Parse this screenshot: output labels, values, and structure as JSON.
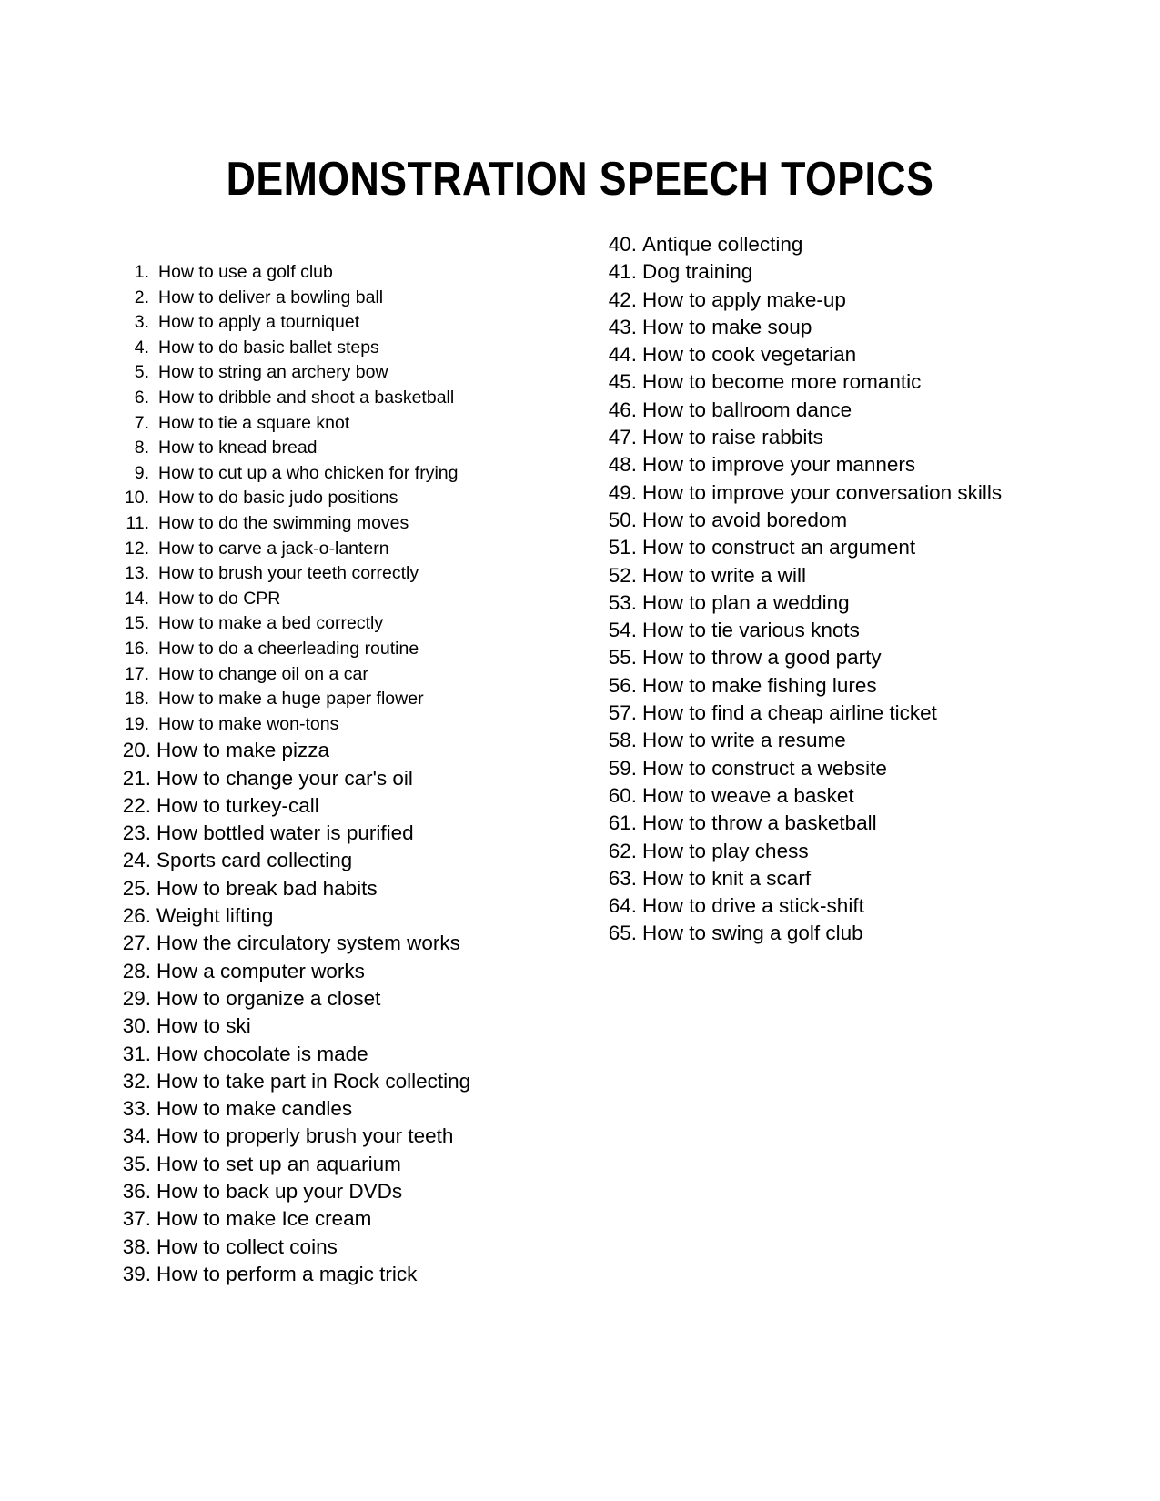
{
  "document": {
    "title": "DEMONSTRATION SPEECH TOPICS",
    "background_color": "#ffffff",
    "text_color": "#000000"
  },
  "columns": {
    "left": {
      "group_small": [
        {
          "number": "1.",
          "text": "How to use a golf club"
        },
        {
          "number": "2.",
          "text": "How to  deliver a bowling ball"
        },
        {
          "number": "3.",
          "text": "How to  apply a tourniquet"
        },
        {
          "number": "4.",
          "text": "How to  do basic ballet steps"
        },
        {
          "number": "5.",
          "text": "How to  string an archery bow"
        },
        {
          "number": "6.",
          "text": "How to  dribble and shoot a basketball"
        },
        {
          "number": "7.",
          "text": "How to  tie a square knot"
        },
        {
          "number": "8.",
          "text": "How to  knead bread"
        },
        {
          "number": "9.",
          "text": "How to  cut up a who chicken for frying"
        },
        {
          "number": "10.",
          "text": "How to  do basic judo positions"
        },
        {
          "number": "11.",
          "text": "How to  do the swimming moves"
        },
        {
          "number": "12.",
          "text": "How to  carve a jack-o-lantern"
        },
        {
          "number": "13.",
          "text": "How to  brush your teeth correctly"
        },
        {
          "number": "14.",
          "text": "How to do CPR"
        },
        {
          "number": "15.",
          "text": "How to make a bed correctly"
        },
        {
          "number": "16.",
          "text": "How to  do a cheerleading routine"
        },
        {
          "number": "17.",
          "text": "How to change oil on a car"
        },
        {
          "number": "18.",
          "text": "How to make a huge paper flower"
        },
        {
          "number": "19.",
          "text": "How to make won-tons"
        }
      ],
      "group_large": [
        {
          "number": "20.",
          "text": "How to make pizza"
        },
        {
          "number": "21.",
          "text": "How to change your car's oil"
        },
        {
          "number": "22.",
          "text": "How to turkey-call"
        },
        {
          "number": "23.",
          "text": "How bottled water is purified"
        },
        {
          "number": "24.",
          "text": "Sports card collecting"
        },
        {
          "number": "25.",
          "text": "How to break bad habits"
        },
        {
          "number": "26.",
          "text": "Weight lifting"
        },
        {
          "number": "27.",
          "text": "How the circulatory system works"
        },
        {
          "number": "28.",
          "text": "How a computer works"
        },
        {
          "number": "29.",
          "text": "How to organize a closet"
        },
        {
          "number": "30.",
          "text": "How to ski"
        },
        {
          "number": "31.",
          "text": "How chocolate is made"
        },
        {
          "number": "32.",
          "text": "How to take part in Rock collecting"
        },
        {
          "number": "33.",
          "text": "How to make candles"
        },
        {
          "number": "34.",
          "text": "How to properly brush your teeth"
        },
        {
          "number": "35.",
          "text": "How to set up an aquarium"
        },
        {
          "number": "36.",
          "text": "How to back up your DVDs"
        },
        {
          "number": "37.",
          "text": "How to make Ice cream"
        },
        {
          "number": "38.",
          "text": "How to collect coins"
        },
        {
          "number": "39.",
          "text": "How to perform a magic trick"
        }
      ]
    },
    "right": {
      "items": [
        {
          "number": "40.",
          "text": "Antique collecting"
        },
        {
          "number": "41.",
          "text": "Dog training"
        },
        {
          "number": "42.",
          "text": "How to apply make-up"
        },
        {
          "number": "43.",
          "text": "How to make soup"
        },
        {
          "number": "44.",
          "text": "How to cook vegetarian"
        },
        {
          "number": "45.",
          "text": "How to become more romantic"
        },
        {
          "number": "46.",
          "text": "How to ballroom dance"
        },
        {
          "number": "47.",
          "text": "How to raise rabbits"
        },
        {
          "number": "48.",
          "text": "How to improve your manners"
        },
        {
          "number": "49.",
          "text": "How to improve your conversation skills"
        },
        {
          "number": "50.",
          "text": "How to avoid boredom"
        },
        {
          "number": "51.",
          "text": "How to construct an argument"
        },
        {
          "number": "52.",
          "text": "How to write a will"
        },
        {
          "number": "53.",
          "text": "How to plan a wedding"
        },
        {
          "number": "54.",
          "text": "How to tie various knots"
        },
        {
          "number": "55.",
          "text": "How to throw a good party"
        },
        {
          "number": "56.",
          "text": "How to make fishing lures"
        },
        {
          "number": "57.",
          "text": "How to find a cheap airline ticket"
        },
        {
          "number": "58.",
          "text": "How to write a resume"
        },
        {
          "number": "59.",
          "text": "How to construct a website"
        },
        {
          "number": "60.",
          "text": "How to weave a basket"
        },
        {
          "number": "61.",
          "text": "How to throw a basketball"
        },
        {
          "number": "62.",
          "text": "How to play chess"
        },
        {
          "number": "63.",
          "text": "How to knit a scarf"
        },
        {
          "number": "64.",
          "text": "How to drive a stick-shift"
        },
        {
          "number": "65.",
          "text": "How to swing a golf club"
        }
      ]
    }
  }
}
